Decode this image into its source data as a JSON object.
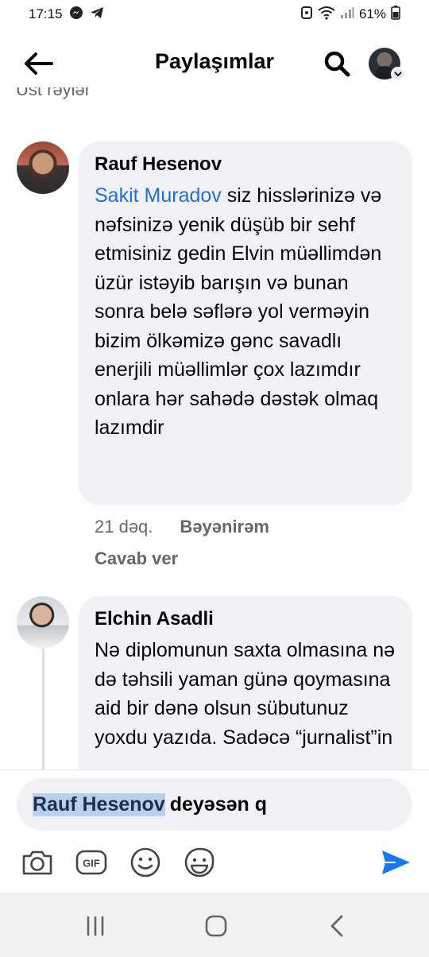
{
  "status_bar": {
    "time": "17:15",
    "battery": "61%"
  },
  "header": {
    "title": "Paylaşımlar"
  },
  "clipped_top_text": "Üst rəylər",
  "comments": [
    {
      "author": "Rauf Hesenov",
      "mention": "Sakit Muradov",
      "text": " siz hisslərinizə və nəfsinizə yenik düşüb bir sehf etmisiniz gedin Elvin müəllimdən üzür istəyib barışın və bunan sonra belə səflərə yol verməyin bizim ölkəmizə gənc savadlı enerjili müəllimlər çox lazımdır onlara hər sahədə dəstək olmaq lazımdir",
      "time": "21 dəq.",
      "like_label": "Bəyənirəm",
      "reply_label": "Cavab ver"
    },
    {
      "author": "Elchin Asadli",
      "text": "Nə diplomunun saxta olmasına nə də təhsili yaman günə qoymasına aid bir dənə olsun sübutunuz yoxdu yazıda. Sadəcə “jurnalist”in"
    }
  ],
  "composer": {
    "mention": "Rauf Hesenov",
    "text": "deyəsən q"
  },
  "icons": {
    "back": "arrow-left-icon",
    "search": "search-icon",
    "camera": "camera-icon",
    "gif": "gif-icon",
    "emoji": "emoji-icon",
    "sticker": "sticker-icon",
    "send": "send-icon"
  },
  "colors": {
    "accent": "#216fdb",
    "bubble": "#f0f2f5",
    "meta": "#65676b"
  }
}
